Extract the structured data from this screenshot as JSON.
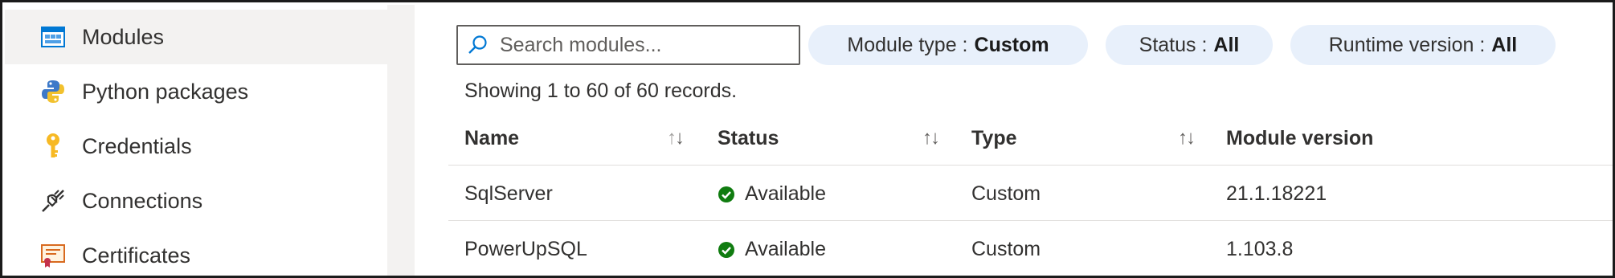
{
  "sidebar": {
    "items": [
      {
        "label": "Modules",
        "icon": "modules-icon",
        "active": true
      },
      {
        "label": "Python packages",
        "icon": "python-icon"
      },
      {
        "label": "Credentials",
        "icon": "key-icon"
      },
      {
        "label": "Connections",
        "icon": "plug-icon"
      },
      {
        "label": "Certificates",
        "icon": "certificate-icon"
      }
    ]
  },
  "toolbar": {
    "search_placeholder": "Search modules...",
    "filters": {
      "module_type_label": "Module type :",
      "module_type_value": "Custom",
      "status_label": "Status :",
      "status_value": "All",
      "runtime_label": "Runtime version :",
      "runtime_value": "All"
    }
  },
  "records_text": "Showing 1 to 60 of 60 records.",
  "table": {
    "columns": [
      "Name",
      "Status",
      "Type",
      "Module version"
    ],
    "rows": [
      {
        "name": "SqlServer",
        "status": "Available",
        "type": "Custom",
        "version": "21.1.18221"
      },
      {
        "name": "PowerUpSQL",
        "status": "Available",
        "type": "Custom",
        "version": "1.103.8"
      }
    ]
  },
  "colors": {
    "accent": "#0078d4",
    "success": "#107c10",
    "pill_bg": "#e8f0fb",
    "active_bg": "#f3f2f1"
  }
}
